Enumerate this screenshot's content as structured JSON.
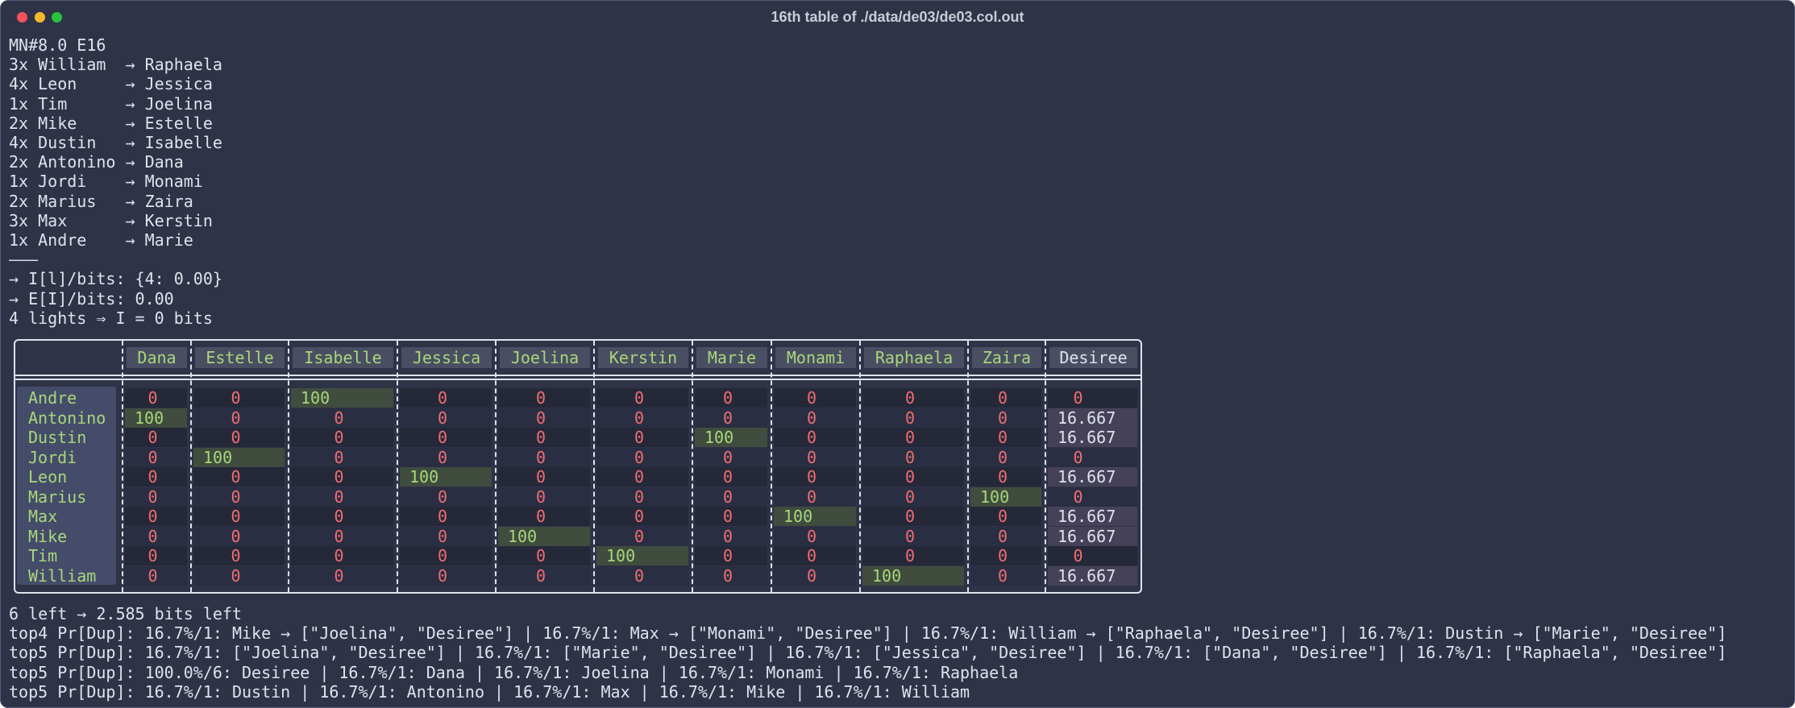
{
  "window": {
    "title": "16th table of ./data/de03/de03.col.out",
    "buttons": [
      "close",
      "minimize",
      "zoom"
    ]
  },
  "header_lines": [
    "MN#8.0 E16",
    "3x William  → Raphaela",
    "4x Leon     → Jessica",
    "1x Tim      → Joelina",
    "2x Mike     → Estelle",
    "4x Dustin   → Isabelle",
    "2x Antonino → Dana",
    "1x Jordi    → Monami",
    "2x Marius   → Zaira",
    "3x Max      → Kerstin",
    "1x Andre    → Marie",
    "———",
    "→ I[l]/bits: {4: 0.00}",
    "→ E[I]/bits: 0.00",
    "4 lights ⇒ I = 0 bits"
  ],
  "table": {
    "columns": [
      "Dana",
      "Estelle",
      "Isabelle",
      "Jessica",
      "Joelina",
      "Kerstin",
      "Marie",
      "Monami",
      "Raphaela",
      "Zaira",
      "Desiree"
    ],
    "rows": [
      {
        "name": "Andre",
        "cells": [
          "0",
          "0",
          "100",
          "0",
          "0",
          "0",
          "0",
          "0",
          "0",
          "0",
          "0"
        ]
      },
      {
        "name": "Antonino",
        "cells": [
          "100",
          "0",
          "0",
          "0",
          "0",
          "0",
          "0",
          "0",
          "0",
          "0",
          "16.667"
        ]
      },
      {
        "name": "Dustin",
        "cells": [
          "0",
          "0",
          "0",
          "0",
          "0",
          "0",
          "100",
          "0",
          "0",
          "0",
          "16.667"
        ]
      },
      {
        "name": "Jordi",
        "cells": [
          "0",
          "100",
          "0",
          "0",
          "0",
          "0",
          "0",
          "0",
          "0",
          "0",
          "0"
        ]
      },
      {
        "name": "Leon",
        "cells": [
          "0",
          "0",
          "0",
          "100",
          "0",
          "0",
          "0",
          "0",
          "0",
          "0",
          "16.667"
        ]
      },
      {
        "name": "Marius",
        "cells": [
          "0",
          "0",
          "0",
          "0",
          "0",
          "0",
          "0",
          "0",
          "0",
          "100",
          "0"
        ]
      },
      {
        "name": "Max",
        "cells": [
          "0",
          "0",
          "0",
          "0",
          "0",
          "0",
          "0",
          "100",
          "0",
          "0",
          "16.667"
        ]
      },
      {
        "name": "Mike",
        "cells": [
          "0",
          "0",
          "0",
          "0",
          "100",
          "0",
          "0",
          "0",
          "0",
          "0",
          "16.667"
        ]
      },
      {
        "name": "Tim",
        "cells": [
          "0",
          "0",
          "0",
          "0",
          "0",
          "100",
          "0",
          "0",
          "0",
          "0",
          "0"
        ]
      },
      {
        "name": "William",
        "cells": [
          "0",
          "0",
          "0",
          "0",
          "0",
          "0",
          "0",
          "0",
          "100",
          "0",
          "16.667"
        ]
      }
    ]
  },
  "footer_lines": [
    "6 left → 2.585 bits left",
    "top4 Pr[Dup]: 16.7%/1: Mike → [\"Joelina\", \"Desiree\"] | 16.7%/1: Max → [\"Monami\", \"Desiree\"] | 16.7%/1: William → [\"Raphaela\", \"Desiree\"] | 16.7%/1: Dustin → [\"Marie\", \"Desiree\"]",
    "top5 Pr[Dup]: 16.7%/1: [\"Joelina\", \"Desiree\"] | 16.7%/1: [\"Marie\", \"Desiree\"] | 16.7%/1: [\"Jessica\", \"Desiree\"] | 16.7%/1: [\"Dana\", \"Desiree\"] | 16.7%/1: [\"Raphaela\", \"Desiree\"]",
    "top5 Pr[Dup]: 100.0%/6: Desiree | 16.7%/1: Dana | 16.7%/1: Joelina | 16.7%/1: Monami | 16.7%/1: Raphaela",
    "top5 Pr[Dup]: 16.7%/1: Dustin | 16.7%/1: Antonino | 16.7%/1: Max | 16.7%/1: Mike | 16.7%/1: William"
  ],
  "colors": {
    "background": "#2f3347",
    "text": "#dfe2ee",
    "zero_value": "#ee6e72",
    "hit_value": "#a8d77a",
    "hit_cell_bg": "#404c3e",
    "desiree_cell_bg": "#454158",
    "row_label_bg": "#454c6a"
  }
}
